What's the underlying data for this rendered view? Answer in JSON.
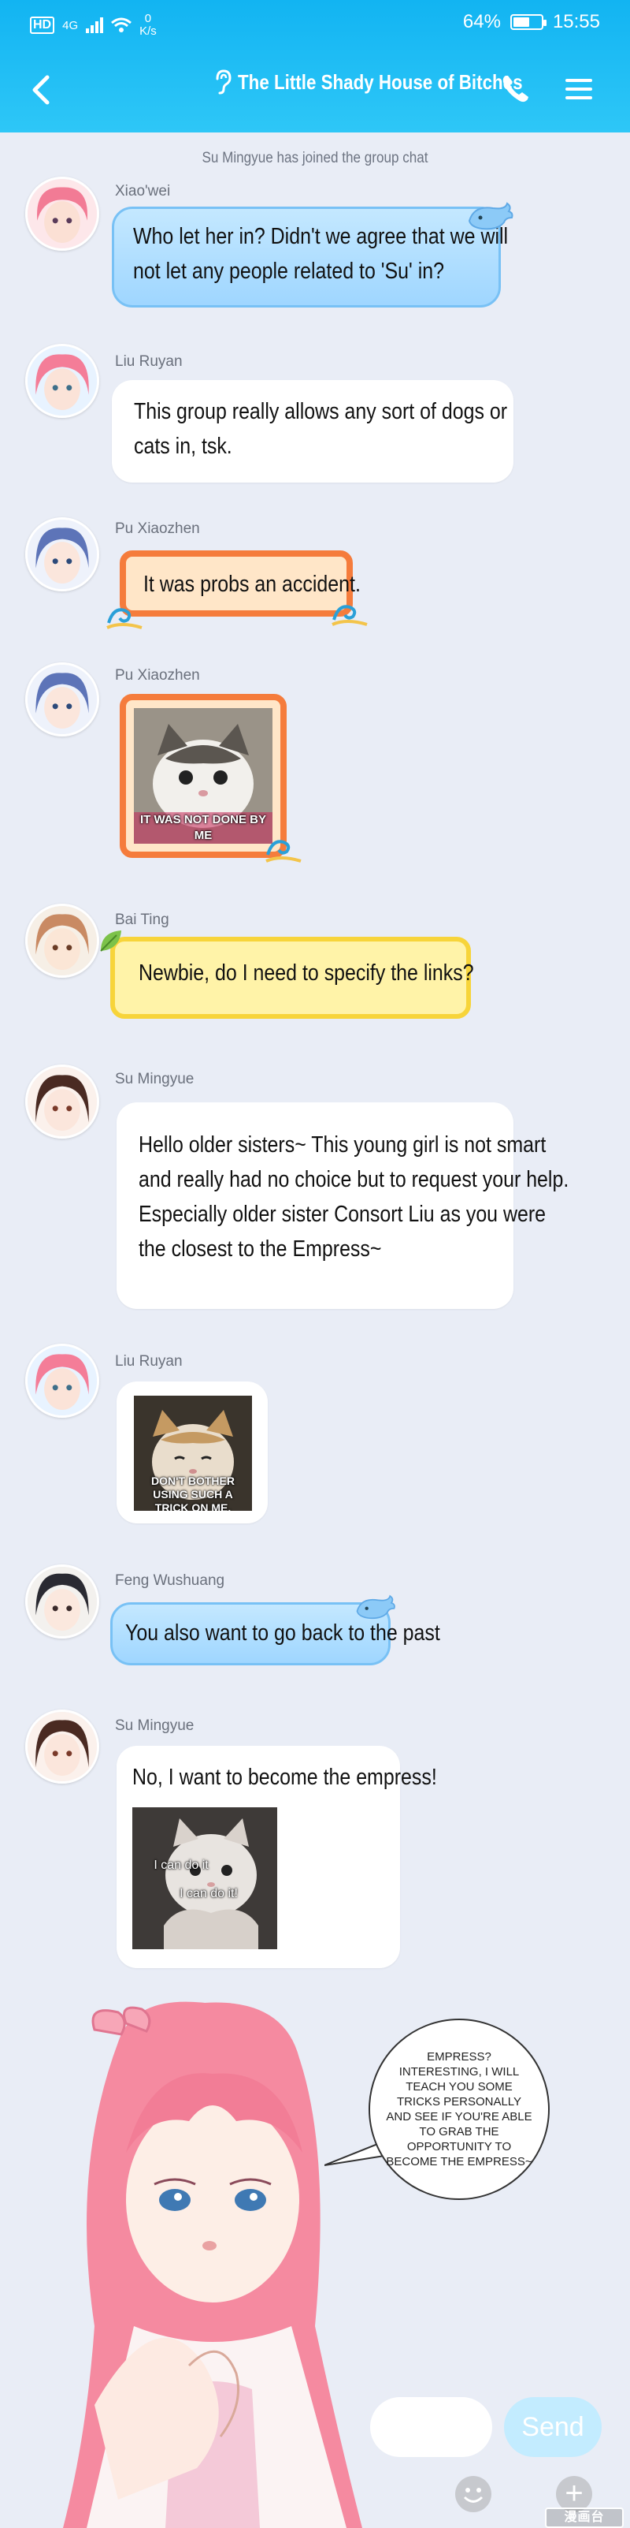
{
  "status_bar": {
    "carrier": "HD",
    "network": "4G",
    "net_speed": "0",
    "net_unit": "K/s",
    "battery": "64%",
    "battery_level": 0.64,
    "time": "15:55"
  },
  "header": {
    "title": "The Little Shady House of Bitches"
  },
  "system_message": "Su Mingyue has joined the group chat",
  "messages": [
    {
      "sender": "Xiao'wei",
      "lines": [
        "Who let her in? Didn't we agree that we will",
        "not let any people related to 'Su' in?"
      ]
    },
    {
      "sender": "Liu Ruyan",
      "lines": [
        "This group really allows any sort of dogs or",
        "cats in, tsk."
      ]
    },
    {
      "sender": "Pu Xiaozhen",
      "lines": [
        "It was probs an accident."
      ]
    },
    {
      "sender": "Pu Xiaozhen",
      "meme_caption": "IT WAS NOT DONE BY ME"
    },
    {
      "sender": "Bai Ting",
      "lines": [
        "Newbie, do I need to specify the links?"
      ]
    },
    {
      "sender": "Su Mingyue",
      "lines": [
        "Hello older sisters~ This young girl is not smart",
        "and really had no choice but to request your help.",
        "Especially older sister Consort Liu as you were",
        "the closest to the Empress~"
      ]
    },
    {
      "sender": "Liu Ruyan",
      "meme_caption": "DON'T BOTHER USING SUCH A TRICK ON ME."
    },
    {
      "sender": "Feng Wushuang",
      "lines": [
        "You also want to go back to the past"
      ]
    },
    {
      "sender": "Su Mingyue",
      "lines": [
        "No, I want to become the empress!"
      ],
      "meme_caption_1": "I can do it",
      "meme_caption_2": "I can do it!"
    }
  ],
  "speech_bubble": "EMPRESS? INTERESTING, I WILL TEACH YOU SOME TRICKS PERSONALLY AND SEE IF YOU'RE ABLE TO GRAB THE OPPORTUNITY TO BECOME THE EMPRESS~",
  "composer": {
    "send_label": "Send"
  },
  "watermark": "漫画台",
  "colors": {
    "header": "#1bb9f4",
    "background": "#e9edf6",
    "blue_bubble": "#a9dbff",
    "orange_bubble": "#f57c3c",
    "yellow_bubble": "#fff3a8"
  }
}
